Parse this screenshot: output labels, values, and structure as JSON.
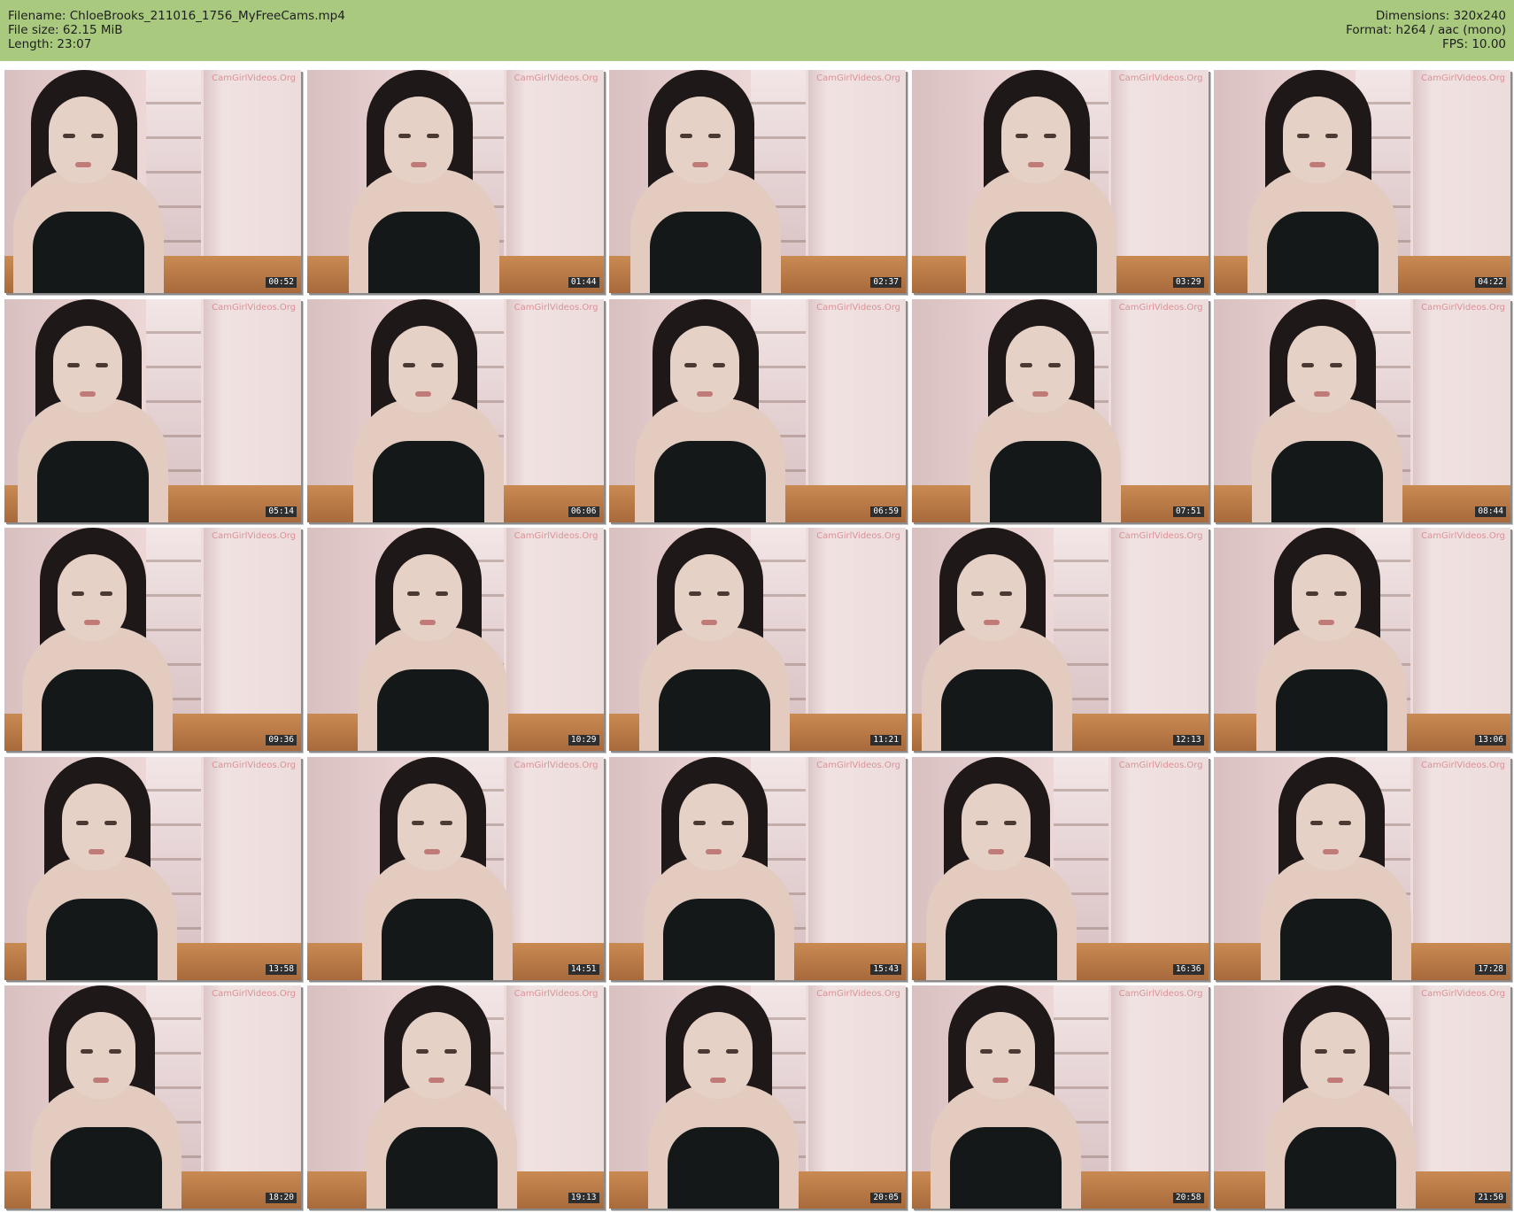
{
  "header": {
    "filename_label": "Filename: ChloeBrooks_211016_1756_MyFreeCams.mp4",
    "filesize_label": "File size: 62.15 MiB",
    "length_label": "Length: 23:07",
    "dimensions_label": "Dimensions: 320x240",
    "format_label": "Format: h264 / aac (mono)",
    "fps_label": "FPS: 10.00",
    "background_color": "#a9c97f"
  },
  "thumbnails": [
    {
      "timestamp": "00:52",
      "watermark": "CamGirlVideos.Org"
    },
    {
      "timestamp": "01:44",
      "watermark": "CamGirlVideos.Org"
    },
    {
      "timestamp": "02:37",
      "watermark": "CamGirlVideos.Org"
    },
    {
      "timestamp": "03:29",
      "watermark": "CamGirlVideos.Org"
    },
    {
      "timestamp": "04:22",
      "watermark": "CamGirlVideos.Org"
    },
    {
      "timestamp": "05:14",
      "watermark": "CamGirlVideos.Org"
    },
    {
      "timestamp": "06:06",
      "watermark": "CamGirlVideos.Org"
    },
    {
      "timestamp": "06:59",
      "watermark": "CamGirlVideos.Org"
    },
    {
      "timestamp": "07:51",
      "watermark": "CamGirlVideos.Org"
    },
    {
      "timestamp": "08:44",
      "watermark": "CamGirlVideos.Org"
    },
    {
      "timestamp": "09:36",
      "watermark": "CamGirlVideos.Org"
    },
    {
      "timestamp": "10:29",
      "watermark": "CamGirlVideos.Org"
    },
    {
      "timestamp": "11:21",
      "watermark": "CamGirlVideos.Org"
    },
    {
      "timestamp": "12:13",
      "watermark": "CamGirlVideos.Org"
    },
    {
      "timestamp": "13:06",
      "watermark": "CamGirlVideos.Org"
    },
    {
      "timestamp": "13:58",
      "watermark": "CamGirlVideos.Org"
    },
    {
      "timestamp": "14:51",
      "watermark": "CamGirlVideos.Org"
    },
    {
      "timestamp": "15:43",
      "watermark": "CamGirlVideos.Org"
    },
    {
      "timestamp": "16:36",
      "watermark": "CamGirlVideos.Org"
    },
    {
      "timestamp": "17:28",
      "watermark": "CamGirlVideos.Org"
    },
    {
      "timestamp": "18:20",
      "watermark": "CamGirlVideos.Org"
    },
    {
      "timestamp": "19:13",
      "watermark": "CamGirlVideos.Org"
    },
    {
      "timestamp": "20:05",
      "watermark": "CamGirlVideos.Org"
    },
    {
      "timestamp": "20:58",
      "watermark": "CamGirlVideos.Org"
    },
    {
      "timestamp": "21:50",
      "watermark": "CamGirlVideos.Org"
    }
  ]
}
